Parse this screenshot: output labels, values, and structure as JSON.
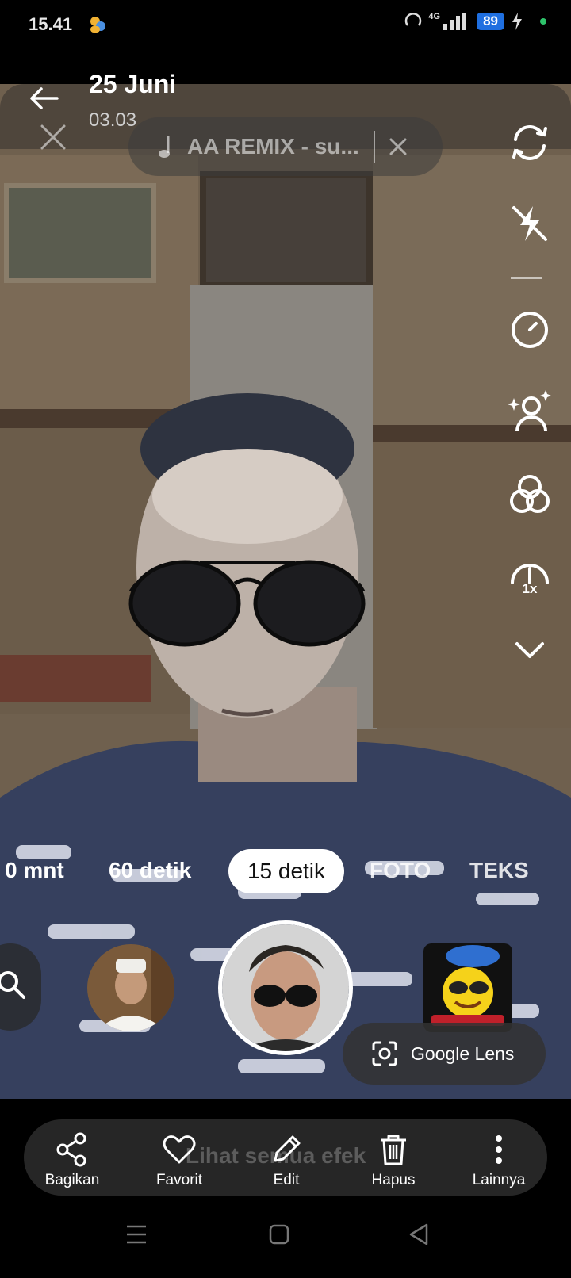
{
  "status_bar": {
    "time": "15.41",
    "network": "4G",
    "battery": "89"
  },
  "header": {
    "date": "25 Juni",
    "time": "03.03",
    "back_icon": "back-arrow-icon"
  },
  "music": {
    "title": "AA REMIX - su..."
  },
  "toolbar": {
    "speed_label": "1x"
  },
  "modes": [
    "0 mnt",
    "60 detik",
    "15 detik",
    "FOTO",
    "TEKS"
  ],
  "active_mode": "15 detik",
  "google_lens": {
    "label": "Google Lens"
  },
  "effects_overlay": {
    "label": "Lihat semua efek"
  },
  "actions": [
    {
      "label": "Bagikan",
      "icon": "share-icon"
    },
    {
      "label": "Favorit",
      "icon": "heart-icon"
    },
    {
      "label": "Edit",
      "icon": "pencil-icon"
    },
    {
      "label": "Hapus",
      "icon": "trash-icon"
    },
    {
      "label": "Lainnya",
      "icon": "more-vertical-icon"
    }
  ]
}
